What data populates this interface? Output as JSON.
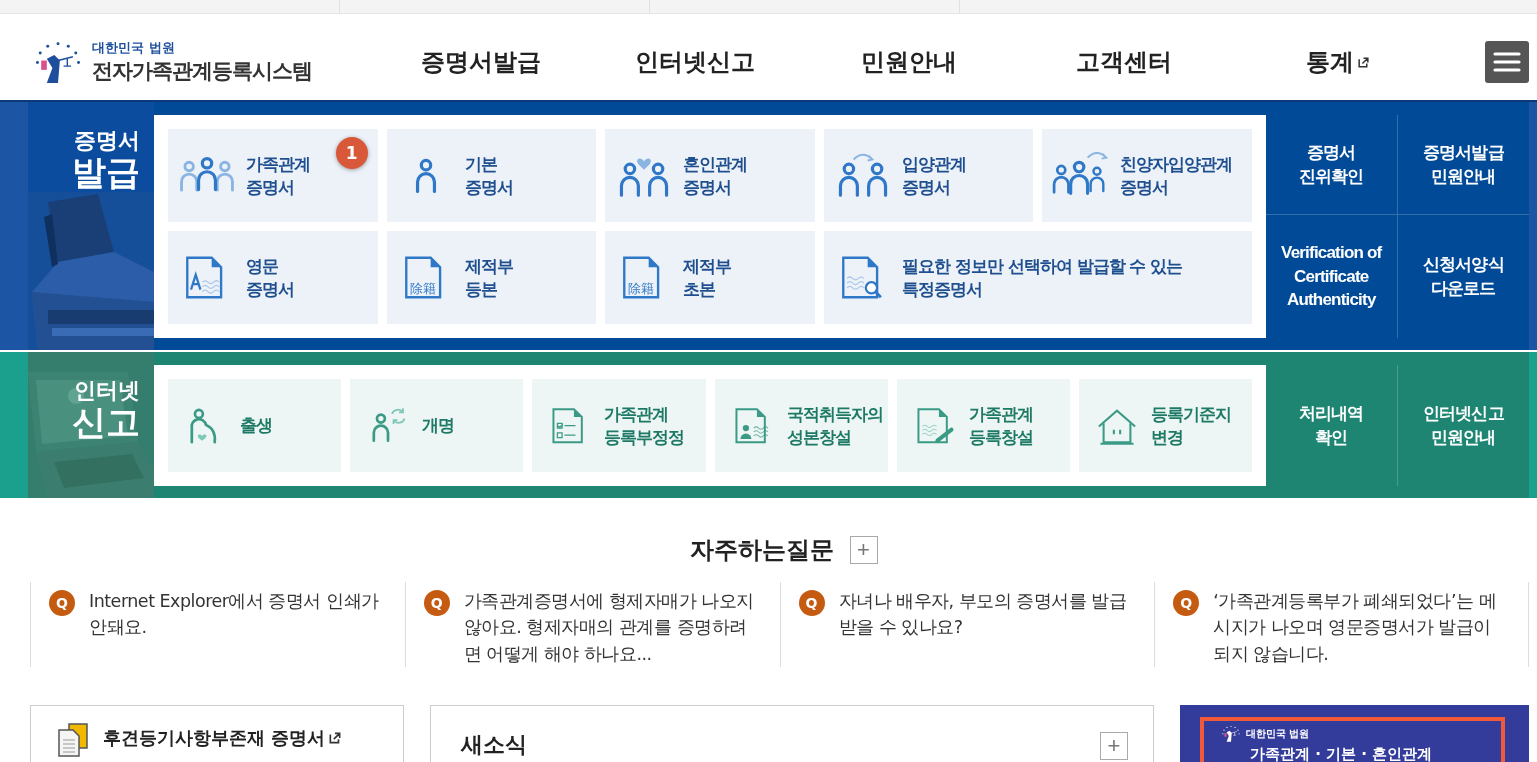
{
  "header": {
    "logo": {
      "org": "대한민국 법원",
      "title": "전자가족관계등록시스템"
    },
    "nav": [
      {
        "label": "증명서발급",
        "external": false
      },
      {
        "label": "인터넷신고",
        "external": false
      },
      {
        "label": "민원안내",
        "external": false
      },
      {
        "label": "고객센터",
        "external": false
      },
      {
        "label": "통계",
        "external": true
      }
    ]
  },
  "sections": [
    {
      "kind": "issue",
      "title_top": "증명서",
      "title_bottom": "발급",
      "tiles": [
        {
          "kind": "family3",
          "text": "가족관계\n증명서",
          "badge": "1",
          "wide": false
        },
        {
          "kind": "person",
          "text": "기본\n증명서",
          "wide": false
        },
        {
          "kind": "couple-heart",
          "text": "혼인관계\n증명서",
          "wide": false
        },
        {
          "kind": "couple-arrows",
          "text": "입양관계\n증명서",
          "wide": false
        },
        {
          "kind": "family-arrow",
          "text": "친양자입양관계\n증명서",
          "wide": false
        },
        {
          "kind": "doc-letter",
          "text": "영문\n증명서",
          "wide": false
        },
        {
          "kind": "doc-chars",
          "icon_text": "除籍",
          "text": "제적부\n등본",
          "wide": false
        },
        {
          "kind": "doc-chars",
          "icon_text": "除籍",
          "text": "제적부\n초본",
          "wide": false
        },
        {
          "kind": "doc-search",
          "text": "필요한 정보만 선택하여 발급할 수 있는\n특정증명서",
          "wide": true
        }
      ],
      "links": [
        "증명서\n진위확인",
        "증명서발급\n민원안내",
        "Verification of\nCertificate\nAuthenticity",
        "신청서양식\n다운로드"
      ]
    },
    {
      "kind": "report",
      "title_top": "인터넷",
      "title_bottom": "신고",
      "tiles": [
        {
          "kind": "pregnant",
          "text": "출생",
          "wide": false
        },
        {
          "kind": "person-refresh",
          "text": "개명",
          "wide": false
        },
        {
          "kind": "doc-check",
          "text": "가족관계\n등록부정정",
          "wide": false
        },
        {
          "kind": "doc-id",
          "text": "국적취득자의\n성본창설",
          "wide": false
        },
        {
          "kind": "doc-pen",
          "text": "가족관계\n등록창설",
          "wide": false
        },
        {
          "kind": "house",
          "text": "등록기준지\n변경",
          "wide": false
        }
      ],
      "links": [
        "처리내역\n확인",
        "인터넷신고\n민원안내"
      ]
    }
  ],
  "faq": {
    "title": "자주하는질문",
    "more": "+",
    "items": [
      {
        "marker": "Q",
        "text": "Internet Explorer에서 증명서 인쇄가 안돼요."
      },
      {
        "marker": "Q",
        "text": "가족관계증명서에 형제자매가 나오지 않아요. 형제자매의 관계를 증명하려면 어떻게 해야 하나요..."
      },
      {
        "marker": "Q",
        "text": "자녀나 배우자, 부모의 증명서를 발급 받을 수 있나요?"
      },
      {
        "marker": "Q",
        "text": "‘가족관계등록부가 폐쇄되었다’는 메시지가 나오며 영문증명서가 발급이 되지 않습니다."
      }
    ]
  },
  "bottom": {
    "document_link": {
      "label": "후견등기사항부존재 증명서",
      "external": true
    },
    "news": {
      "title": "새소식",
      "more": "+"
    },
    "banner": {
      "org": "대한민국 법원",
      "text": "가족관계 · 기본 · 혼인관계"
    }
  }
}
